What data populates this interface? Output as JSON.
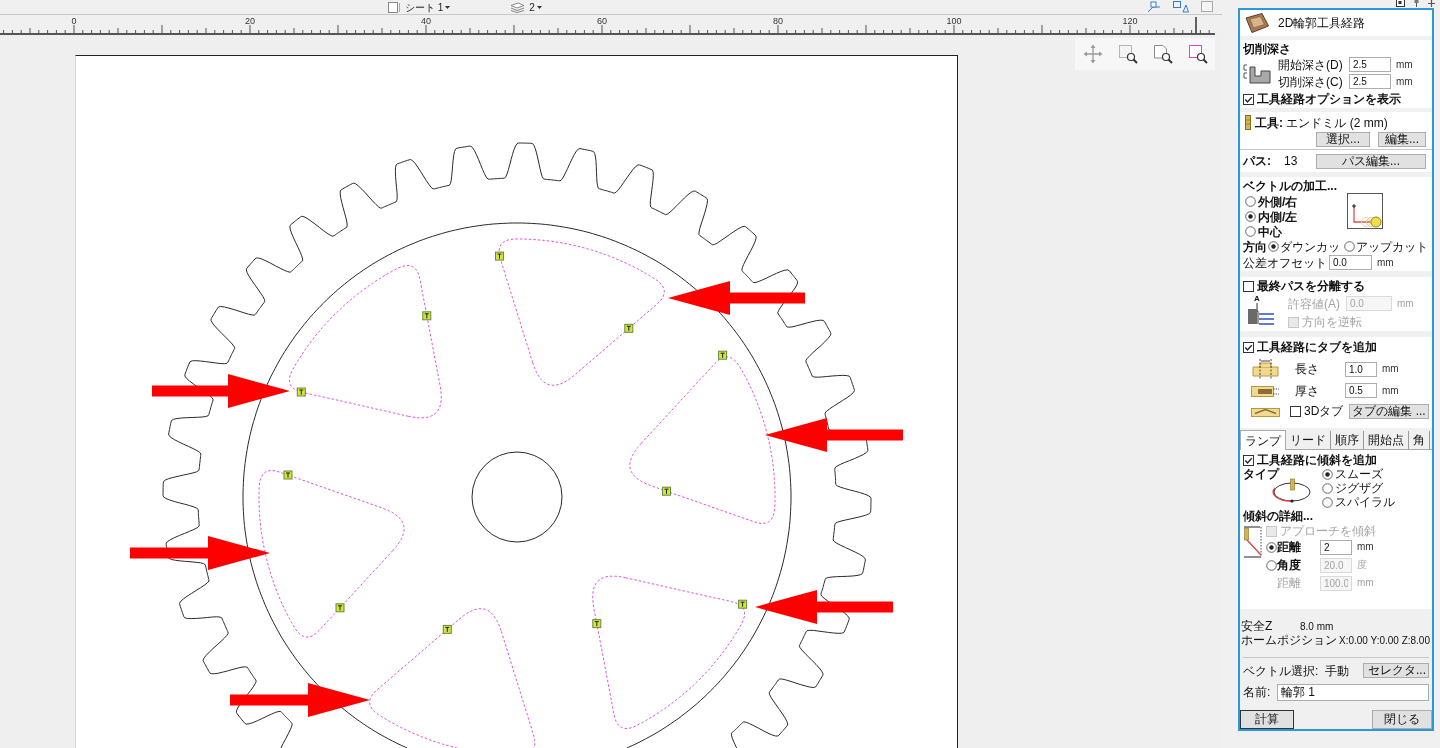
{
  "toolbar": {
    "sheet": "シート 1",
    "layer_count": "2"
  },
  "ruler": {
    "labels": [
      "0",
      "20",
      "40",
      "60",
      "80",
      "100",
      "120"
    ]
  },
  "panel": {
    "title": "2D輪郭工具経路",
    "cut_depth": {
      "heading": "切削深さ",
      "fields": [
        {
          "label": "開始深さ(D)",
          "value": "2.5",
          "unit": "mm"
        },
        {
          "label": "切削深さ(C)",
          "value": "2.5",
          "unit": "mm"
        }
      ]
    },
    "show_options": {
      "label": "工具経路オプションを表示",
      "checked": true
    },
    "tool": {
      "text": "**工具:** エンドミル (2 mm)",
      "buttons": [
        "選択...",
        "編集..."
      ]
    },
    "passes": {
      "label": "パス:",
      "value": "13",
      "button": "パス編集..."
    },
    "machine_vectors": {
      "heading": "ベクトルの加工...",
      "sides": [
        {
          "label": "外側/右",
          "selected": false
        },
        {
          "label": "内側/左",
          "selected": true
        },
        {
          "label": "中心",
          "selected": false
        }
      ],
      "direction_label": "方向",
      "directions": [
        {
          "label": "ダウンカッ",
          "selected": true
        },
        {
          "label": "アップカット",
          "selected": false
        }
      ],
      "offset": {
        "label": "公差オフセット",
        "value": "0.0",
        "unit": "mm"
      }
    },
    "final_pass": {
      "label": "最終パスを分離する",
      "checked": false,
      "icon_letter": "A",
      "allowance": {
        "label": "許容値(A)",
        "value": "0.0",
        "unit": "mm",
        "disabled": true
      },
      "reverse": {
        "label": "方向を逆転",
        "checked": false,
        "disabled": true
      }
    },
    "tabs": {
      "label": "工具経路にタブを追加",
      "checked": true,
      "fields": [
        {
          "label": "長さ",
          "value": "1.0",
          "unit": "mm"
        },
        {
          "label": "厚さ",
          "value": "0.5",
          "unit": "mm"
        }
      ],
      "tab_3d": {
        "label": "3Dタブ",
        "checked": false
      },
      "edit_button": "タブの編集 ..."
    },
    "option_tabs": [
      {
        "label": "ランプ",
        "selected": true
      },
      {
        "label": "リード",
        "selected": false
      },
      {
        "label": "順序",
        "selected": false
      },
      {
        "label": "開始点",
        "selected": false
      },
      {
        "label": "角",
        "selected": false
      }
    ],
    "ramp": {
      "label": "工具経路に傾斜を追加",
      "checked": true,
      "type_label": "タイプ",
      "types": [
        {
          "label": "スムーズ",
          "selected": true
        },
        {
          "label": "ジグザグ",
          "selected": false
        },
        {
          "label": "スパイラル",
          "selected": false
        }
      ],
      "details_heading": "傾斜の詳細...",
      "approach": {
        "label": "アプローチを傾斜",
        "checked": false,
        "disabled": true
      },
      "rows": [
        {
          "kind": "radio",
          "label": "距離",
          "selected": true,
          "value": "2",
          "unit": "mm",
          "disabled": false
        },
        {
          "kind": "radio",
          "label": "角度",
          "selected": false,
          "value": "20.0",
          "unit": "度",
          "disabled": true
        },
        {
          "kind": "plain",
          "label": "距離",
          "value": "100.0",
          "unit": "mm",
          "disabled": true
        }
      ]
    },
    "info": {
      "safe_z_label": "安全Z",
      "safe_z": "8.0 mm",
      "home_label": "ホームポジション",
      "home": "X:0.00 Y:0.00 Z:8.00"
    },
    "vector_selection": {
      "label": "ベクトル選択:",
      "value": "手動",
      "button": "セレクタ..."
    },
    "name": {
      "label": "名前:",
      "value": "輪郭 1"
    },
    "buttons": [
      {
        "label": "計算",
        "default": true
      },
      {
        "label": "閉じる",
        "default": false
      }
    ]
  }
}
